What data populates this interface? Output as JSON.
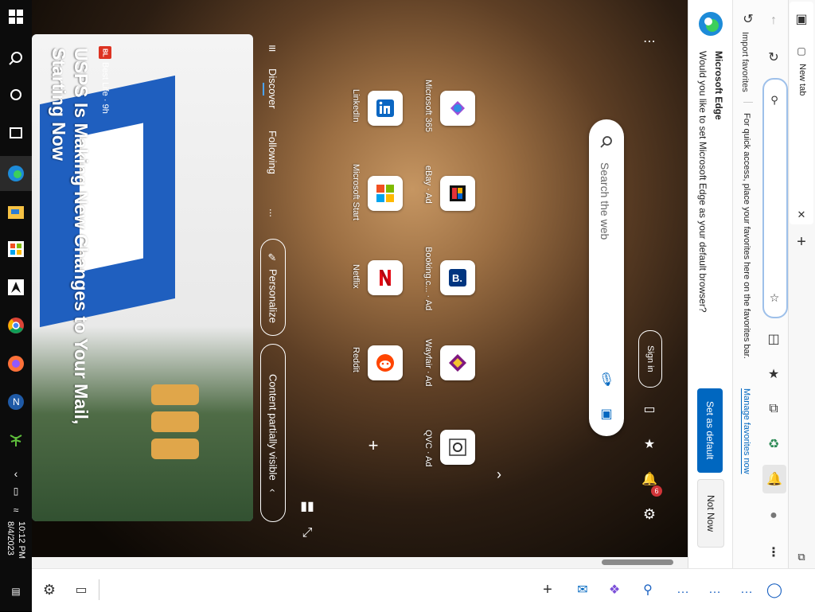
{
  "browser": {
    "tab_label": "New tab",
    "search_placeholder": "Search the web",
    "sign_in": "Sign in",
    "notification_count": "6"
  },
  "infobar": {
    "title": "Microsoft Edge",
    "question": "Would you like to set Microsoft Edge as your default browser?",
    "set_default": "Set as default",
    "not_now": "Not Now"
  },
  "favorites_bar": {
    "import": "Import favorites",
    "hint": "For quick access, place your favorites here on the favorites bar.",
    "manage": "Manage favorites now"
  },
  "quick_links": [
    {
      "label": "Microsoft 365",
      "icon": "microsoft-365-icon"
    },
    {
      "label": "eBay · Ad",
      "icon": "ebay-icon"
    },
    {
      "label": "Booking.c... · Ad",
      "icon": "booking-icon"
    },
    {
      "label": "Wayfair · Ad",
      "icon": "wayfair-icon"
    },
    {
      "label": "QVC · Ad",
      "icon": "qvc-icon"
    },
    {
      "label": "LinkedIn",
      "icon": "linkedin-icon"
    },
    {
      "label": "Microsoft Start",
      "icon": "microsoft-start-icon"
    },
    {
      "label": "Netflix",
      "icon": "netflix-icon"
    },
    {
      "label": "Reddit",
      "icon": "reddit-icon"
    }
  ],
  "feed": {
    "discover": "Discover",
    "following": "Following",
    "more": "...",
    "personalize": "Personalize",
    "content_visible": "Content partially visible"
  },
  "news": {
    "badge": "BL",
    "source": "Best Life · 9h",
    "title": "USPS Is Making New Changes to Your Mail, Starting Now"
  },
  "taskbar": {
    "time": "10:12 PM",
    "date": "8/4/2023"
  },
  "colors": {
    "accent": "#0067c0",
    "badge": "#d13438"
  }
}
